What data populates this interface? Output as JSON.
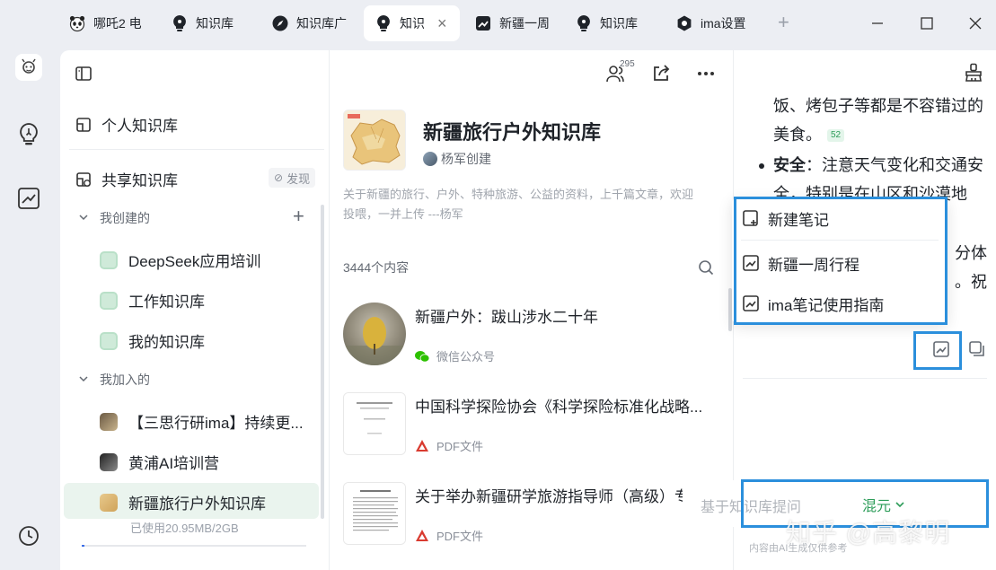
{
  "tabs": [
    {
      "label": "哪吒2 电",
      "icon": "panda-icon"
    },
    {
      "label": "知识库",
      "icon": "bulb-icon"
    },
    {
      "label": "知识库广",
      "icon": "compass-icon"
    },
    {
      "label": "知识",
      "icon": "bulb-icon",
      "active": true
    },
    {
      "label": "新疆一周",
      "icon": "note-icon"
    },
    {
      "label": "知识库",
      "icon": "bulb-icon"
    },
    {
      "label": "ima设置",
      "icon": "gear-icon"
    }
  ],
  "sidebar": {
    "personal_kb": "个人知识库",
    "shared_kb": "共享知识库",
    "discover": "发现",
    "created_group": "我创建的",
    "created_items": [
      "DeepSeek应用培训",
      "工作知识库",
      "我的知识库"
    ],
    "joined_group": "我加入的",
    "joined_items": [
      "【三思行研ima】持续更...",
      "黄浦AI培训营",
      "新疆旅行户外知识库"
    ],
    "usage": "已使用20.95MB/2GB",
    "usage_fraction": 0.01
  },
  "kb": {
    "member_count": "295",
    "title": "新疆旅行户外知识库",
    "creator": "杨军创建",
    "description": "关于新疆的旅行、户外、特种旅游、公益的资料，上千篇文章，欢迎投喂，一并上传 ---杨军",
    "content_count": "3444个内容",
    "docs": [
      {
        "title": "新疆户外：跋山涉水二十年",
        "source": "微信公众号",
        "source_icon": "wechat-icon"
      },
      {
        "title": "中国科学探险协会《科学探险标准化战略...",
        "source": "PDF文件",
        "source_icon": "pdf-icon"
      },
      {
        "title": "关于举办新疆研学旅游指导师（高级）专...",
        "source": "PDF文件",
        "source_icon": "pdf-icon"
      }
    ]
  },
  "answer": {
    "line1": "饭、烤包子等都是不容错过的",
    "line2": "美食。",
    "cite": "52",
    "line3_bold": "安全",
    "line3_rest": "：注意天气变化和交通安",
    "line4": "全，特别是在山区和沙漠地",
    "line5_tail": "分体",
    "line6_tail": "。祝"
  },
  "popup": {
    "items": [
      "新建笔记",
      "新疆一周行程",
      "ima笔记使用指南"
    ]
  },
  "ask": {
    "placeholder": "基于知识库提问",
    "model": "混元"
  },
  "disclaimer": "内容由AI生成仅供参考",
  "watermark": "知乎 @高黎明",
  "colors": {
    "accent_green": "#2e9d5a",
    "highlight_blue": "#2b8fdc"
  }
}
